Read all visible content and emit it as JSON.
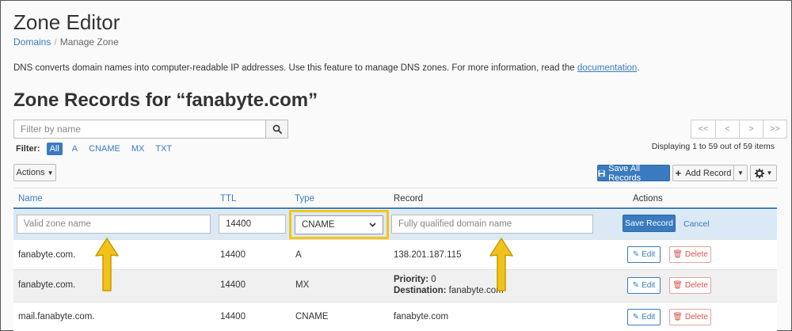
{
  "header": {
    "title": "Zone Editor",
    "breadcrumb": [
      {
        "label": "Domains",
        "link": true
      },
      {
        "label": "Manage Zone",
        "link": false
      }
    ],
    "description": "DNS converts domain names into computer-readable IP addresses. Use this feature to manage DNS zones. For more information, read the",
    "description_link": "documentation",
    "description_end": "."
  },
  "section": {
    "title": "Zone Records for “fanabyte.com”"
  },
  "search": {
    "placeholder": "Filter by name",
    "icon": "search-icon"
  },
  "filter": {
    "label": "Filter:",
    "chips": [
      "All",
      "A",
      "CNAME",
      "MX",
      "TXT"
    ],
    "active": "All"
  },
  "pagination": {
    "buttons": [
      "<<",
      "<",
      ">",
      ">>"
    ],
    "status": "Displaying 1 to 59 out of 59 items"
  },
  "toolbar": {
    "actions_label": "Actions",
    "save_all_label": "Save All Records",
    "add_record_label": "Add Record",
    "accent": "#3a7bbf"
  },
  "table": {
    "columns": [
      "Name",
      "TTL",
      "Type",
      "Record",
      "Actions"
    ],
    "edit_row": {
      "name_placeholder": "Valid zone name",
      "ttl_value": "14400",
      "type_value": "CNAME",
      "record_placeholder": "Fully qualified domain name",
      "save_label": "Save Record",
      "cancel_label": "Cancel"
    },
    "rows": [
      {
        "name": "fanabyte.com.",
        "ttl": "14400",
        "type": "A",
        "record": "138.201.187.115"
      },
      {
        "name": "fanabyte.com.",
        "ttl": "14400",
        "type": "MX",
        "priority_label": "Priority:",
        "priority": "0",
        "destination_label": "Destination:",
        "destination": "fanabyte.com"
      },
      {
        "name": "mail.fanabyte.com.",
        "ttl": "14400",
        "type": "CNAME",
        "record": "fanabyte.com"
      }
    ],
    "edit_label": "Edit",
    "delete_label": "Delete"
  },
  "annotations": {
    "highlight_color": "#f5c518",
    "arrow_color": "#f2c21b"
  }
}
